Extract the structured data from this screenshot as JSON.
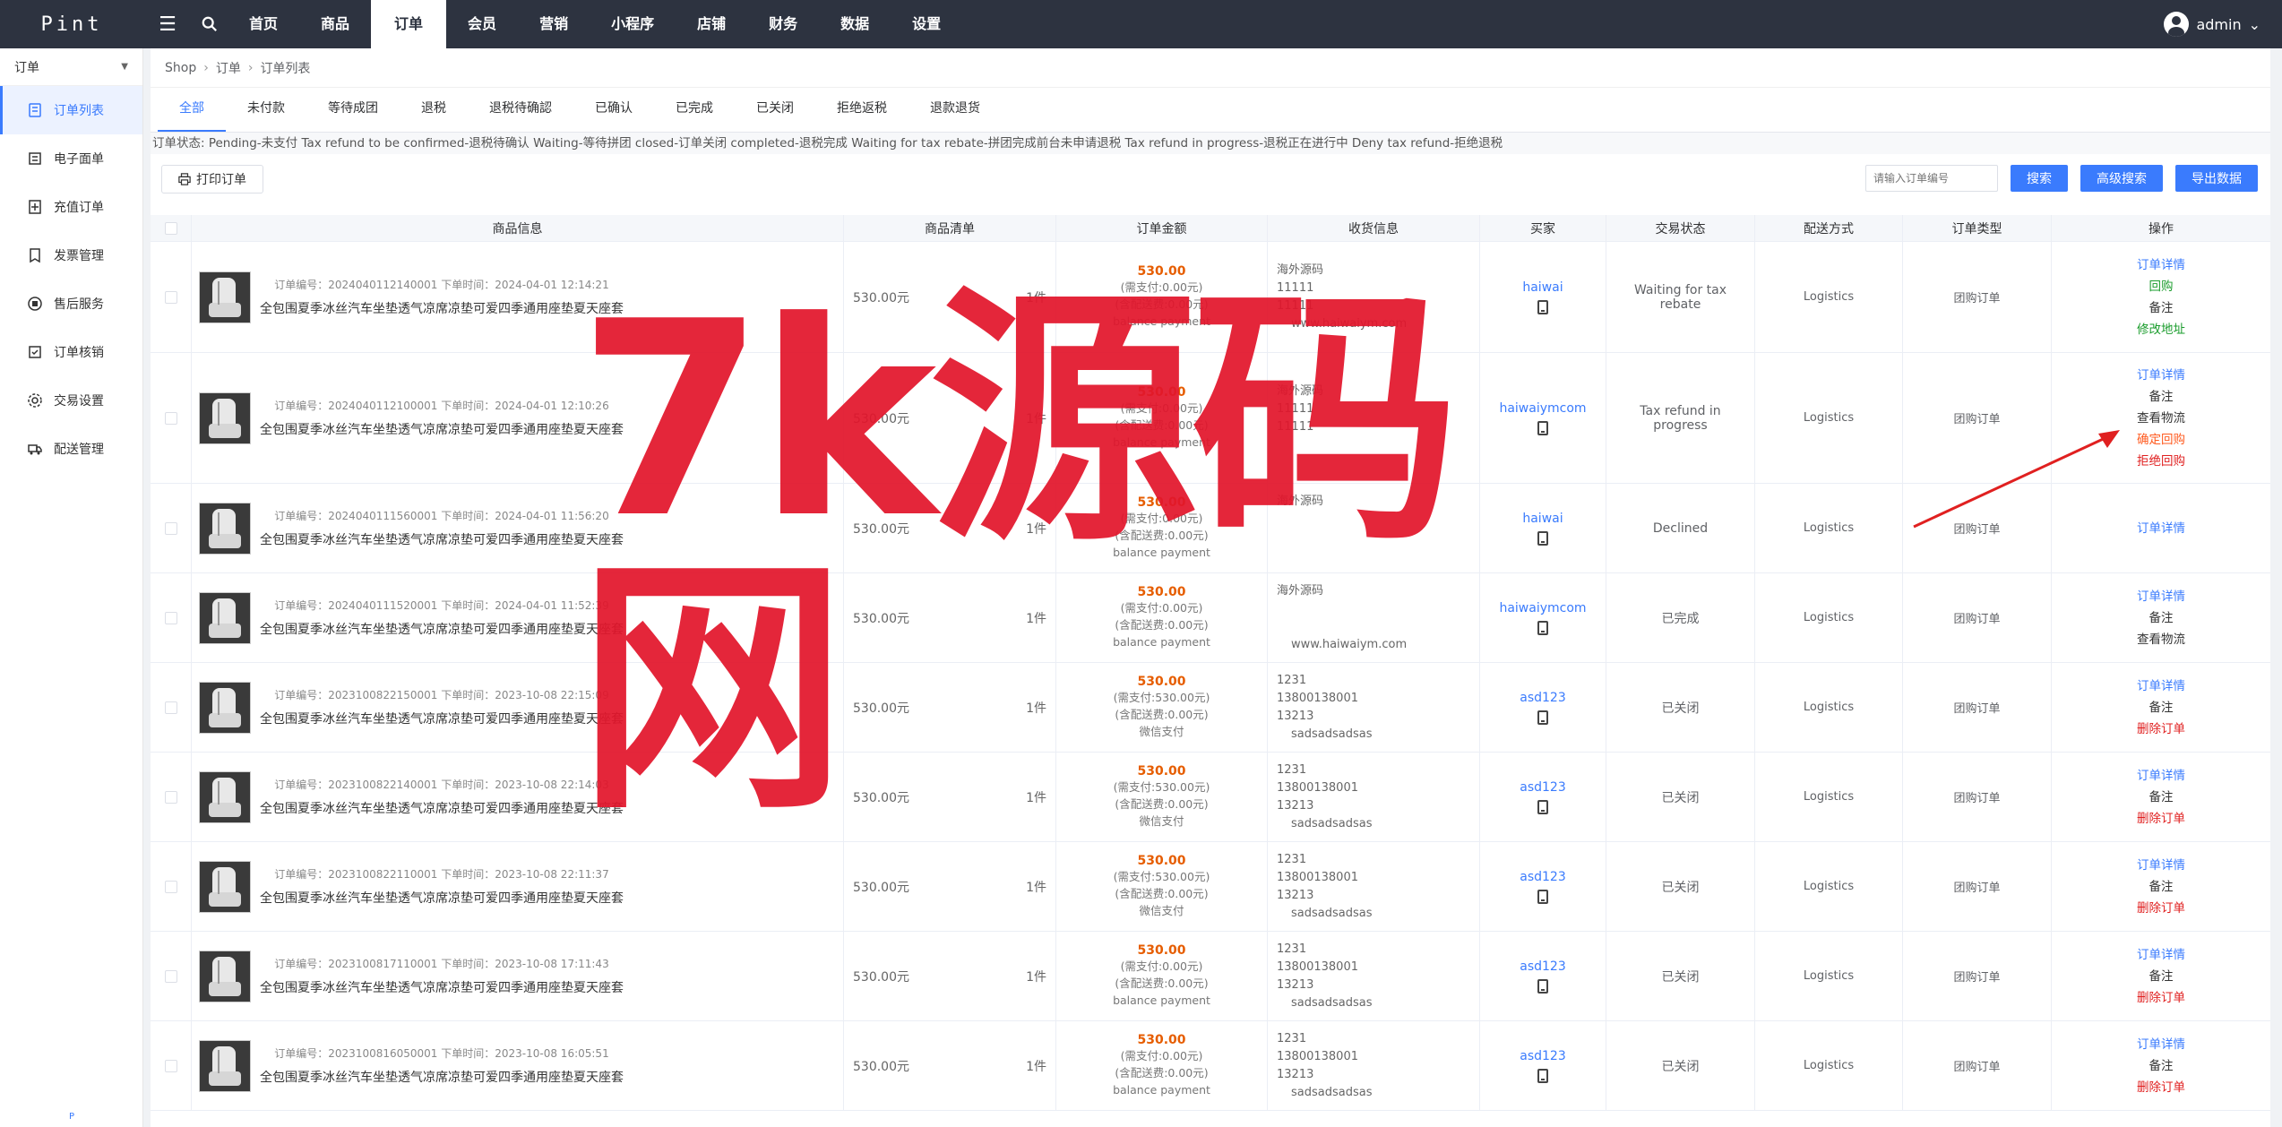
{
  "app": {
    "logo": "Pint"
  },
  "topnav": [
    "首页",
    "商品",
    "订单",
    "会员",
    "营销",
    "小程序",
    "店铺",
    "财务",
    "数据",
    "设置"
  ],
  "topnav_active": 2,
  "user": {
    "name": "admin",
    "caret": "⌄"
  },
  "sidebar": {
    "header": "订单",
    "items": [
      "订单列表",
      "电子面单",
      "充值订单",
      "发票管理",
      "售后服务",
      "订单核销",
      "交易设置",
      "配送管理"
    ],
    "bottom": "P"
  },
  "breadcrumb": [
    "Shop",
    "订单",
    "订单列表"
  ],
  "tabs": [
    "全部",
    "未付款",
    "等待成团",
    "退税",
    "退税待确認",
    "已确认",
    "已完成",
    "已关闭",
    "拒绝返税",
    "退款退货"
  ],
  "status_note": "订单状态: Pending-未支付 Tax refund to be confirmed-退税待确认 Waiting-等待拼团 closed-订单关闭 completed-退税完成 Waiting for tax rebate-拼团完成前台未申请退税 Tax refund in progress-退税正在进行中 Deny tax refund-拒绝退税",
  "toolbar": {
    "print": "打印订单",
    "search_placeholder": "请输入订单编号",
    "search": "搜索",
    "advanced": "高级搜索",
    "export": "导出数据"
  },
  "columns": [
    "商品信息",
    "商品清单",
    "订单金额",
    "收货信息",
    "买家",
    "交易状态",
    "配送方式",
    "订单类型",
    "操作"
  ],
  "orders": [
    {
      "meta": "订单编号：2024040112140001 下单时间：2024-04-01 12:14:21",
      "name": "全包围夏季冰丝汽车坐垫透气凉席凉垫可爱四季通用座垫夏天座套",
      "price": "530.00元",
      "qty": "1件",
      "total": "530.00",
      "paid": "(需支付:0.00元)",
      "fee": "(含配送费:0.00元)",
      "pay": "balance payment",
      "addr": [
        "海外源码",
        "11111",
        "11111",
        "www.haiwaiym.com"
      ],
      "buyer": "haiwai",
      "status": "Waiting for tax rebate",
      "ship": "Logistics",
      "type": "团购订单",
      "ops": [
        {
          "t": "订单详情",
          "c": "blue"
        },
        {
          "t": "回购",
          "c": "green"
        },
        {
          "t": "备注",
          "c": "dark"
        },
        {
          "t": "修改地址",
          "c": "green"
        }
      ]
    },
    {
      "meta": "订单编号：2024040112100001 下单时间：2024-04-01 12:10:26",
      "name": "全包围夏季冰丝汽车坐垫透气凉席凉垫可爱四季通用座垫夏天座套",
      "price": "530.00元",
      "qty": "1件",
      "total": "530.00",
      "paid": "(需支付:0.00元)",
      "fee": "(含配送费:0.00元)",
      "pay": "balance payment",
      "addr": [
        "海外源码",
        "11111",
        "11111",
        ""
      ],
      "buyer": "haiwaiymcom",
      "status": "Tax refund in progress",
      "ship": "Logistics",
      "type": "团购订单",
      "ops": [
        {
          "t": "订单详情",
          "c": "blue"
        },
        {
          "t": "备注",
          "c": "dark"
        },
        {
          "t": "查看物流",
          "c": "dark"
        },
        {
          "t": "确定回购",
          "c": "orange"
        },
        {
          "t": "拒绝回购",
          "c": "red"
        }
      ]
    },
    {
      "meta": "订单编号：2024040111560001 下单时间：2024-04-01 11:56:20",
      "name": "全包围夏季冰丝汽车坐垫透气凉席凉垫可爱四季通用座垫夏天座套",
      "price": "530.00元",
      "qty": "1件",
      "total": "530.00",
      "paid": "(需支付:0.00元)",
      "fee": "(含配送费:0.00元)",
      "pay": "balance payment",
      "addr": [
        "海外源码",
        "",
        "",
        ""
      ],
      "buyer": "haiwai",
      "status": "Declined",
      "ship": "Logistics",
      "type": "团购订单",
      "ops": [
        {
          "t": "订单详情",
          "c": "blue"
        }
      ]
    },
    {
      "meta": "订单编号：2024040111520001 下单时间：2024-04-01 11:52:39",
      "name": "全包围夏季冰丝汽车坐垫透气凉席凉垫可爱四季通用座垫夏天座套",
      "price": "530.00元",
      "qty": "1件",
      "total": "530.00",
      "paid": "(需支付:0.00元)",
      "fee": "(含配送费:0.00元)",
      "pay": "balance payment",
      "addr": [
        "海外源码",
        "",
        "",
        "www.haiwaiym.com"
      ],
      "buyer": "haiwaiymcom",
      "status": "已完成",
      "ship": "Logistics",
      "type": "团购订单",
      "ops": [
        {
          "t": "订单详情",
          "c": "blue"
        },
        {
          "t": "备注",
          "c": "dark"
        },
        {
          "t": "查看物流",
          "c": "dark"
        }
      ]
    },
    {
      "meta": "订单编号：2023100822150001 下单时间：2023-10-08 22:15:09",
      "name": "全包围夏季冰丝汽车坐垫透气凉席凉垫可爱四季通用座垫夏天座套",
      "price": "530.00元",
      "qty": "1件",
      "total": "530.00",
      "paid": "(需支付:530.00元)",
      "fee": "(含配送费:0.00元)",
      "pay": "微信支付",
      "addr": [
        "1231",
        "13800138001",
        "13213",
        "sadsadsadsas"
      ],
      "buyer": "asd123",
      "status": "已关闭",
      "ship": "Logistics",
      "type": "团购订单",
      "ops": [
        {
          "t": "订单详情",
          "c": "blue"
        },
        {
          "t": "备注",
          "c": "dark"
        },
        {
          "t": "删除订单",
          "c": "red"
        }
      ]
    },
    {
      "meta": "订单编号：2023100822140001 下单时间：2023-10-08 22:14:03",
      "name": "全包围夏季冰丝汽车坐垫透气凉席凉垫可爱四季通用座垫夏天座套",
      "price": "530.00元",
      "qty": "1件",
      "total": "530.00",
      "paid": "(需支付:530.00元)",
      "fee": "(含配送费:0.00元)",
      "pay": "微信支付",
      "addr": [
        "1231",
        "13800138001",
        "13213",
        "sadsadsadsas"
      ],
      "buyer": "asd123",
      "status": "已关闭",
      "ship": "Logistics",
      "type": "团购订单",
      "ops": [
        {
          "t": "订单详情",
          "c": "blue"
        },
        {
          "t": "备注",
          "c": "dark"
        },
        {
          "t": "删除订单",
          "c": "red"
        }
      ]
    },
    {
      "meta": "订单编号：2023100822110001 下单时间：2023-10-08 22:11:37",
      "name": "全包围夏季冰丝汽车坐垫透气凉席凉垫可爱四季通用座垫夏天座套",
      "price": "530.00元",
      "qty": "1件",
      "total": "530.00",
      "paid": "(需支付:530.00元)",
      "fee": "(含配送费:0.00元)",
      "pay": "微信支付",
      "addr": [
        "1231",
        "13800138001",
        "13213",
        "sadsadsadsas"
      ],
      "buyer": "asd123",
      "status": "已关闭",
      "ship": "Logistics",
      "type": "团购订单",
      "ops": [
        {
          "t": "订单详情",
          "c": "blue"
        },
        {
          "t": "备注",
          "c": "dark"
        },
        {
          "t": "删除订单",
          "c": "red"
        }
      ]
    },
    {
      "meta": "订单编号：2023100817110001 下单时间：2023-10-08 17:11:43",
      "name": "全包围夏季冰丝汽车坐垫透气凉席凉垫可爱四季通用座垫夏天座套",
      "price": "530.00元",
      "qty": "1件",
      "total": "530.00",
      "paid": "(需支付:0.00元)",
      "fee": "(含配送费:0.00元)",
      "pay": "balance payment",
      "addr": [
        "1231",
        "13800138001",
        "13213",
        "sadsadsadsas"
      ],
      "buyer": "asd123",
      "status": "已关闭",
      "ship": "Logistics",
      "type": "团购订单",
      "ops": [
        {
          "t": "订单详情",
          "c": "blue"
        },
        {
          "t": "备注",
          "c": "dark"
        },
        {
          "t": "删除订单",
          "c": "red"
        }
      ]
    },
    {
      "meta": "订单编号：2023100816050001 下单时间：2023-10-08 16:05:51",
      "name": "全包围夏季冰丝汽车坐垫透气凉席凉垫可爱四季通用座垫夏天座套",
      "price": "530.00元",
      "qty": "1件",
      "total": "530.00",
      "paid": "(需支付:0.00元)",
      "fee": "(含配送费:0.00元)",
      "pay": "balance payment",
      "addr": [
        "1231",
        "13800138001",
        "13213",
        "sadsadsadsas"
      ],
      "buyer": "asd123",
      "status": "已关闭",
      "ship": "Logistics",
      "type": "团购订单",
      "ops": [
        {
          "t": "订单详情",
          "c": "blue"
        },
        {
          "t": "备注",
          "c": "dark"
        },
        {
          "t": "删除订单",
          "c": "red"
        }
      ]
    }
  ],
  "watermark": "7k源码网",
  "colors": {
    "topbar": "#2d3340",
    "accent": "#3a7bfd",
    "price": "#e65d00",
    "watermark": "#e2162c"
  }
}
